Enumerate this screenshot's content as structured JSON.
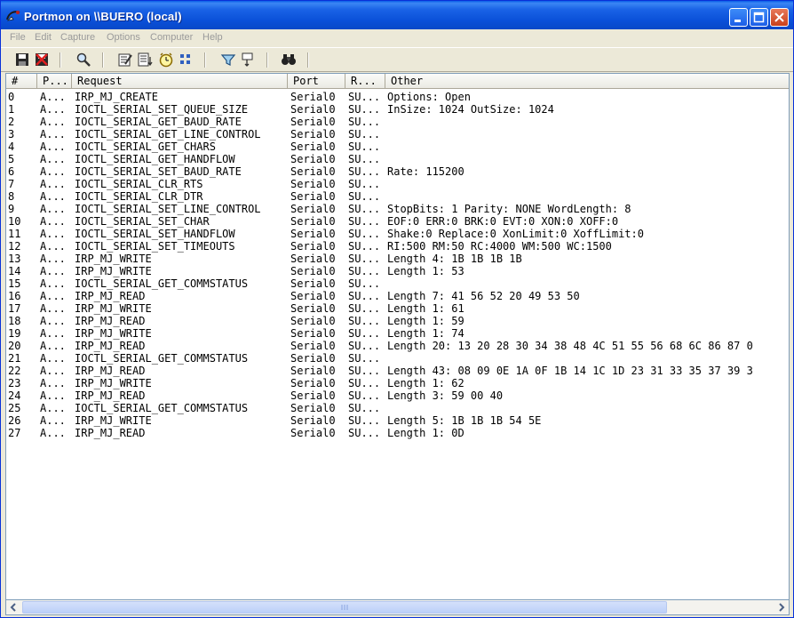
{
  "window": {
    "title": "Portmon on \\\\BUERO (local)"
  },
  "menu": [
    "File",
    "Edit",
    "Capture",
    "Options",
    "Computer",
    "Help"
  ],
  "toolbar": {
    "icons": [
      "save-icon",
      "clear-log-icon",
      "find-icon",
      "capture-icon",
      "autoscroll-icon",
      "timestamp-icon",
      "ports-icon",
      "filter-icon",
      "highlight-icon",
      "binoculars-icon"
    ]
  },
  "columns": [
    "#",
    "P...",
    "Request",
    "Port",
    "R...",
    "Other"
  ],
  "rows": [
    [
      "0",
      "A...",
      "IRP_MJ_CREATE",
      "Serial0",
      "SU...",
      "Options: Open"
    ],
    [
      "1",
      "A...",
      "IOCTL_SERIAL_SET_QUEUE_SIZE",
      "Serial0",
      "SU...",
      "InSize: 1024 OutSize: 1024"
    ],
    [
      "2",
      "A...",
      "IOCTL_SERIAL_GET_BAUD_RATE",
      "Serial0",
      "SU...",
      ""
    ],
    [
      "3",
      "A...",
      "IOCTL_SERIAL_GET_LINE_CONTROL",
      "Serial0",
      "SU...",
      ""
    ],
    [
      "4",
      "A...",
      "IOCTL_SERIAL_GET_CHARS",
      "Serial0",
      "SU...",
      ""
    ],
    [
      "5",
      "A...",
      "IOCTL_SERIAL_GET_HANDFLOW",
      "Serial0",
      "SU...",
      ""
    ],
    [
      "6",
      "A...",
      "IOCTL_SERIAL_SET_BAUD_RATE",
      "Serial0",
      "SU...",
      "Rate: 115200"
    ],
    [
      "7",
      "A...",
      "IOCTL_SERIAL_CLR_RTS",
      "Serial0",
      "SU...",
      ""
    ],
    [
      "8",
      "A...",
      "IOCTL_SERIAL_CLR_DTR",
      "Serial0",
      "SU...",
      ""
    ],
    [
      "9",
      "A...",
      "IOCTL_SERIAL_SET_LINE_CONTROL",
      "Serial0",
      "SU...",
      "StopBits: 1 Parity: NONE WordLength: 8"
    ],
    [
      "10",
      "A...",
      "IOCTL_SERIAL_SET_CHAR",
      "Serial0",
      "SU...",
      "EOF:0 ERR:0 BRK:0 EVT:0 XON:0 XOFF:0"
    ],
    [
      "11",
      "A...",
      "IOCTL_SERIAL_SET_HANDFLOW",
      "Serial0",
      "SU...",
      "Shake:0 Replace:0 XonLimit:0 XoffLimit:0"
    ],
    [
      "12",
      "A...",
      "IOCTL_SERIAL_SET_TIMEOUTS",
      "Serial0",
      "SU...",
      "RI:500 RM:50 RC:4000 WM:500 WC:1500"
    ],
    [
      "13",
      "A...",
      "IRP_MJ_WRITE",
      "Serial0",
      "SU...",
      "Length 4: 1B 1B 1B 1B"
    ],
    [
      "14",
      "A...",
      "IRP_MJ_WRITE",
      "Serial0",
      "SU...",
      "Length 1: 53"
    ],
    [
      "15",
      "A...",
      "IOCTL_SERIAL_GET_COMMSTATUS",
      "Serial0",
      "SU...",
      ""
    ],
    [
      "16",
      "A...",
      "IRP_MJ_READ",
      "Serial0",
      "SU...",
      "Length 7: 41 56 52 20 49 53 50"
    ],
    [
      "17",
      "A...",
      "IRP_MJ_WRITE",
      "Serial0",
      "SU...",
      "Length 1: 61"
    ],
    [
      "18",
      "A...",
      "IRP_MJ_READ",
      "Serial0",
      "SU...",
      "Length 1: 59"
    ],
    [
      "19",
      "A...",
      "IRP_MJ_WRITE",
      "Serial0",
      "SU...",
      "Length 1: 74"
    ],
    [
      "20",
      "A...",
      "IRP_MJ_READ",
      "Serial0",
      "SU...",
      "Length 20: 13 20 28 30 34 38 48 4C 51 55 56 68 6C 86 87 0"
    ],
    [
      "21",
      "A...",
      "IOCTL_SERIAL_GET_COMMSTATUS",
      "Serial0",
      "SU...",
      ""
    ],
    [
      "22",
      "A...",
      "IRP_MJ_READ",
      "Serial0",
      "SU...",
      "Length 43: 08 09 0E 1A 0F 1B 14 1C 1D 23 31 33 35 37 39 3"
    ],
    [
      "23",
      "A...",
      "IRP_MJ_WRITE",
      "Serial0",
      "SU...",
      "Length 1: 62"
    ],
    [
      "24",
      "A...",
      "IRP_MJ_READ",
      "Serial0",
      "SU...",
      "Length 3: 59 00 40"
    ],
    [
      "25",
      "A...",
      "IOCTL_SERIAL_GET_COMMSTATUS",
      "Serial0",
      "SU...",
      ""
    ],
    [
      "26",
      "A...",
      "IRP_MJ_WRITE",
      "Serial0",
      "SU...",
      "Length 5: 1B 1B 1B 54 5E"
    ],
    [
      "27",
      "A...",
      "IRP_MJ_READ",
      "Serial0",
      "SU...",
      "Length 1: 0D"
    ]
  ]
}
